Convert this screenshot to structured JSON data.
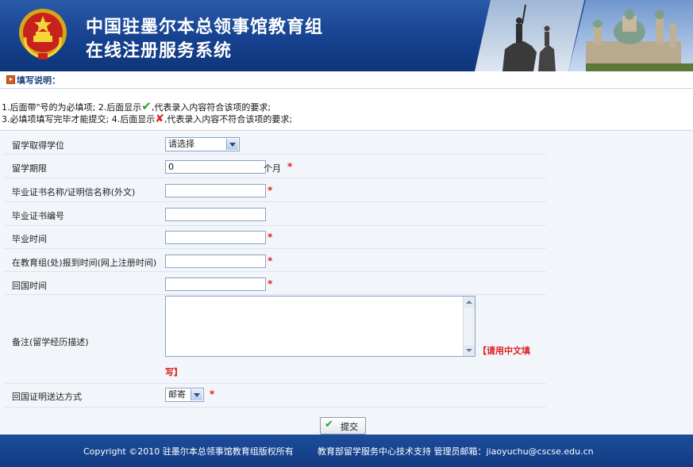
{
  "header": {
    "title_line1": "中国驻墨尔本总领事馆教育组",
    "title_line2": "在线注册服务系统"
  },
  "notice": {
    "heading": "填写说明：",
    "line1_a": "1.后面带\"号的为必填项;    2.后面显示",
    "line1_b": ",代表录入内容符合该项的要求;",
    "line2_a": "3.必填项填写完毕才能提交; 4.后面显示",
    "line2_b": ",代表录入内容不符合该项的要求;",
    "check_icon": "checkmark-green",
    "x_icon": "cross-red"
  },
  "form": {
    "degree": {
      "label": "留学取得学位",
      "selected": "请选择"
    },
    "duration": {
      "label": "留学期限",
      "value": "0",
      "unit": "个月",
      "required": "*"
    },
    "cert_name": {
      "label": "毕业证书名称/证明信名称(外文)",
      "value": "",
      "required": "*"
    },
    "cert_no": {
      "label": "毕业证书编号",
      "value": ""
    },
    "grad_time": {
      "label": "毕业时间",
      "value": "",
      "required": "*"
    },
    "report_time": {
      "label": "在教育组(处)报到时间(网上注册时间)",
      "value": "",
      "required": "*"
    },
    "return_time": {
      "label": "回国时间",
      "value": "",
      "required": "*"
    },
    "remarks": {
      "label": "备注(留学经历描述)",
      "value": "",
      "note_a": "【请用中文填",
      "note_b": "写】"
    },
    "delivery": {
      "label": "回国证明送达方式",
      "selected": "邮寄",
      "required": "*"
    },
    "submit_label": "提交"
  },
  "footer": {
    "copyright": "Copyright ©2010 驻墨尔本总领事馆教育组版权所有",
    "support": "教育部留学服务中心技术支持  管理员邮箱：jiaoyuchu@cscse.edu.cn"
  },
  "colors": {
    "banner": "#15418f",
    "footer": "#123b82",
    "required": "#e02020",
    "form_bg": "#f2f5fa"
  }
}
